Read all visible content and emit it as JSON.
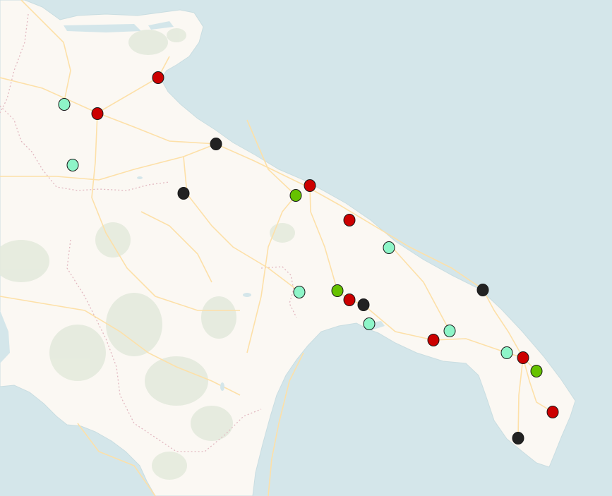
{
  "map": {
    "colors": {
      "sea": "#d4e6ea",
      "land": "#fbf8f3",
      "roads": "#fde0a8",
      "forest": "#e4eadd",
      "border": "#e2b8c0",
      "coast": "#c9dde1"
    },
    "marker_legend": {
      "#cc0000": "red",
      "#222222": "dark-gray",
      "#8ef5c8": "mint",
      "#66c200": "green"
    },
    "markers": [
      {
        "id": "m1",
        "color": "#cc0000"
      },
      {
        "id": "m2",
        "color": "#8ef5c8"
      },
      {
        "id": "m3",
        "color": "#cc0000"
      },
      {
        "id": "m4",
        "color": "#8ef5c8"
      },
      {
        "id": "m5",
        "color": "#222222"
      },
      {
        "id": "m6",
        "color": "#222222"
      },
      {
        "id": "m7",
        "color": "#66c200"
      },
      {
        "id": "m8",
        "color": "#cc0000"
      },
      {
        "id": "m9",
        "color": "#cc0000"
      },
      {
        "id": "m10",
        "color": "#8ef5c8"
      },
      {
        "id": "m11",
        "color": "#8ef5c8"
      },
      {
        "id": "m12",
        "color": "#66c200"
      },
      {
        "id": "m13",
        "color": "#cc0000"
      },
      {
        "id": "m14",
        "color": "#222222"
      },
      {
        "id": "m15",
        "color": "#8ef5c8"
      },
      {
        "id": "m16",
        "color": "#222222"
      },
      {
        "id": "m17",
        "color": "#cc0000"
      },
      {
        "id": "m18",
        "color": "#8ef5c8"
      },
      {
        "id": "m19",
        "color": "#8ef5c8"
      },
      {
        "id": "m20",
        "color": "#cc0000"
      },
      {
        "id": "m21",
        "color": "#66c200"
      },
      {
        "id": "m22",
        "color": "#cc0000"
      },
      {
        "id": "m23",
        "color": "#222222"
      }
    ]
  }
}
